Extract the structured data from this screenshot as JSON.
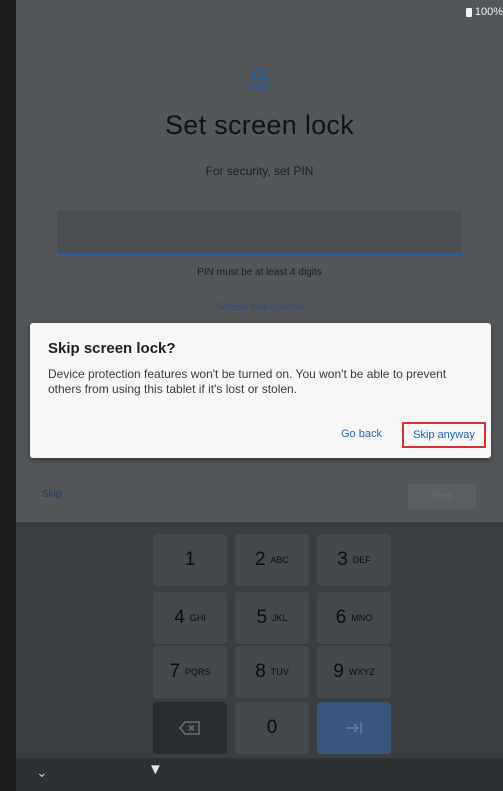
{
  "status_bar": {
    "battery": "100%"
  },
  "setup": {
    "lock_icon": "lock-icon",
    "title": "Set screen lock",
    "subtitle": "For security, set PIN",
    "pin_hint": "PIN must be at least 4 digits",
    "screen_lock_options": "Screen lock options"
  },
  "dialog": {
    "title": "Skip screen lock?",
    "body": "Device protection features won't be turned on. You won't be able to prevent others from using this tablet if it's lost or stolen.",
    "go_back": "Go back",
    "skip_anyway": "Skip anyway"
  },
  "footer": {
    "skip": "Skip",
    "next": "Next"
  },
  "keypad": {
    "keys": [
      {
        "digit": "1",
        "letters": ""
      },
      {
        "digit": "2",
        "letters": "ABC"
      },
      {
        "digit": "3",
        "letters": "DEF"
      },
      {
        "digit": "4",
        "letters": "GHI"
      },
      {
        "digit": "5",
        "letters": "JKL"
      },
      {
        "digit": "6",
        "letters": "MNO"
      },
      {
        "digit": "7",
        "letters": "PQRS"
      },
      {
        "digit": "8",
        "letters": "TUV"
      },
      {
        "digit": "9",
        "letters": "WXYZ"
      }
    ],
    "zero": "0",
    "delete_icon": "backspace-icon",
    "enter_icon": "enter-arrow-icon"
  },
  "nav_bar": {
    "hide_keyboard_icon": "chevron-down-icon",
    "back_icon": "back-triangle-icon"
  },
  "colors": {
    "accent": "#1a66b8",
    "highlight": "#d93232",
    "dialog_bg": "#f7f7f7"
  }
}
